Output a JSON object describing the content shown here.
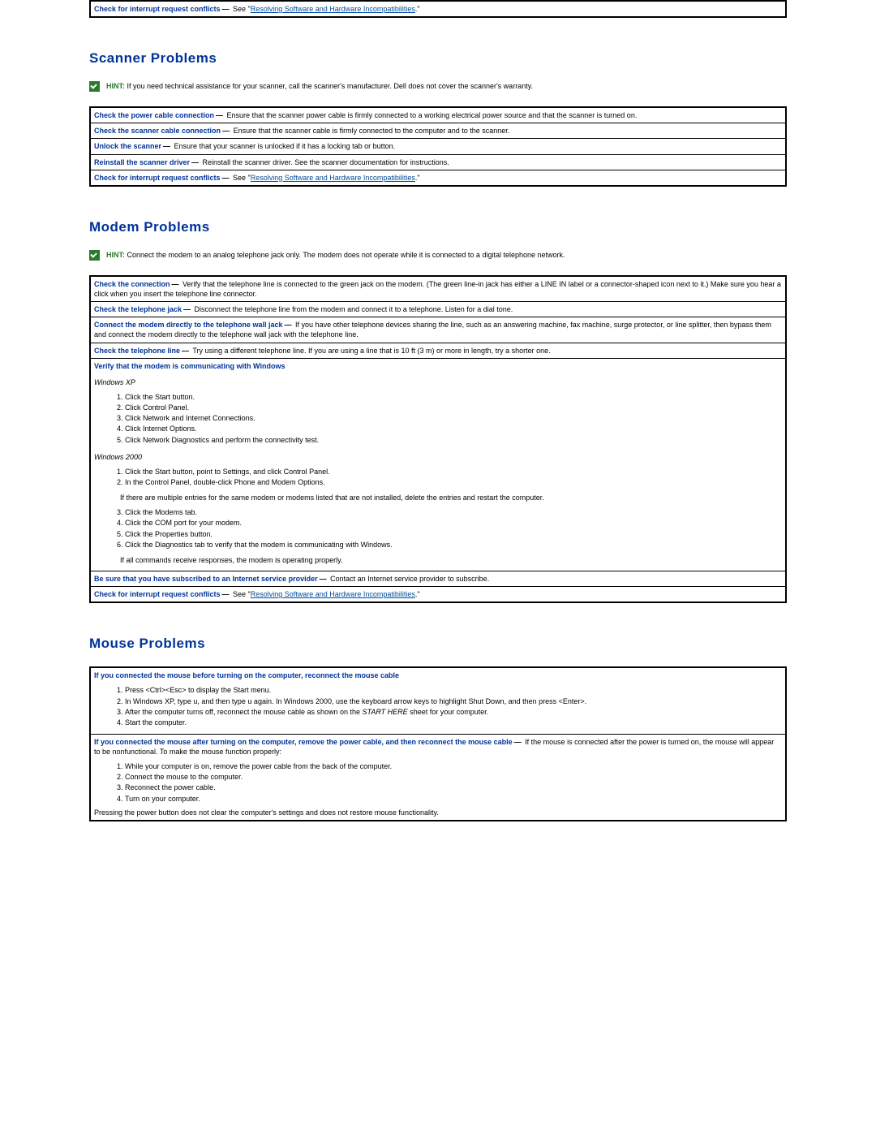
{
  "topOrphan": {
    "title": "Check for interrupt request conflicts",
    "sep": "—",
    "pre": " See \"",
    "link": "Resolving Software and Hardware Incompatibilities",
    "post": ".\""
  },
  "scanner": {
    "heading": "Scanner Problems",
    "hint": {
      "label": "HINT:",
      "text": " If you need technical assistance for your scanner, call the scanner's manufacturer. Dell does not cover the scanner's warranty."
    },
    "rows": [
      {
        "title": "Check the power cable connection",
        "sep": "—",
        "text": " Ensure that the scanner power cable is firmly connected to a working electrical power source and that the scanner is turned on."
      },
      {
        "title": "Check the scanner cable connection",
        "sep": "—",
        "text": " Ensure that the scanner cable is firmly connected to the computer and to the scanner."
      },
      {
        "title": "Unlock the scanner",
        "sep": "—",
        "text": " Ensure that your scanner is unlocked if it has a locking tab or button."
      },
      {
        "title": "Reinstall the scanner driver",
        "sep": "—",
        "text": " Reinstall the scanner driver. See the scanner documentation for instructions."
      },
      {
        "title": "Check for interrupt request conflicts",
        "sep": "—",
        "pre": " See \"",
        "link": "Resolving Software and Hardware Incompatibilities",
        "post": ".\""
      }
    ]
  },
  "modem": {
    "heading": "Modem Problems",
    "hint": {
      "label": "HINT:",
      "text": " Connect the modem to an analog telephone jack only. The modem does not operate while it is connected to a digital telephone network."
    },
    "rows": {
      "r1": {
        "title": "Check the connection",
        "sep": "—",
        "text": " Verify that the telephone line is connected to the green jack on the modem. (The green line-in jack has either a LINE IN label or a connector-shaped icon next to it.) Make sure you hear a click when you insert the telephone line connector."
      },
      "r2": {
        "title": "Check the telephone jack",
        "sep": "—",
        "text": " Disconnect the telephone line from the modem and connect it to a telephone. Listen for a dial tone."
      },
      "r3": {
        "title": "Connect the modem directly to the telephone wall jack",
        "sep": "—",
        "text": " If you have other telephone devices sharing the line, such as an answering machine, fax machine, surge protector, or line splitter, then bypass them and connect the modem directly to the telephone wall jack with the telephone line."
      },
      "r4": {
        "title": "Check the telephone line",
        "sep": "—",
        "text": " Try using a different telephone line. If you are using a line that is 10 ft (3 m) or more in length, try a shorter one."
      },
      "r5": {
        "title": "Verify that the modem is communicating with Windows",
        "xpLabel": "Windows XP",
        "xpSteps": [
          "Click the Start button.",
          "Click Control Panel.",
          "Click Network and Internet Connections.",
          "Click Internet Options.",
          "Click Network Diagnostics and perform the connectivity test."
        ],
        "w2kLabel": "Windows 2000",
        "w2kStepsA": [
          "Click the Start button, point to Settings, and click Control Panel.",
          "In the Control Panel, double-click Phone and Modem Options."
        ],
        "noteA": "If there are multiple entries for the same modem or modems listed that are not installed, delete the entries and restart the computer.",
        "w2kStepsB": [
          "Click the Modems tab.",
          "Click the COM port for your modem.",
          "Click the Properties button.",
          "Click the Diagnostics tab to verify that the modem is communicating with Windows."
        ],
        "noteB": "If all commands receive responses, the modem is operating properly."
      },
      "r6": {
        "title": "Be sure that you have subscribed to an Internet service provider",
        "sep": "—",
        "text": " Contact an Internet service provider to subscribe."
      },
      "r7": {
        "title": "Check for interrupt request conflicts",
        "sep": "—",
        "pre": " See \"",
        "link": "Resolving Software and Hardware Incompatibilities",
        "post": ".\""
      }
    }
  },
  "mouse": {
    "heading": "Mouse Problems",
    "rows": {
      "r1": {
        "title": "If you connected the mouse before turning on the computer, reconnect the mouse cable",
        "steps": [
          "Press <Ctrl><Esc> to display the Start menu.",
          "In Windows XP, type u, and then type u again. In Windows 2000, use the keyboard arrow keys to highlight Shut Down, and then press <Enter>.",
          "After the computer turns off, reconnect the mouse cable as shown on the ",
          "Start the computer."
        ],
        "startHere": "START HERE",
        "step3tail": " sheet for your computer."
      },
      "r2": {
        "title": "If you connected the mouse after turning on the computer, remove the power cable, and then reconnect the mouse cable",
        "sep": "—",
        "text": " If the mouse is connected after the power is turned on, the mouse will appear to be nonfunctional. To make the mouse function properly:",
        "steps": [
          "While your computer is on, remove the power cable from the back of the computer.",
          "Connect the mouse to the computer.",
          "Reconnect the power cable.",
          "Turn on your computer."
        ],
        "tail": "Pressing the power button does not clear the computer's settings and does not restore mouse functionality."
      }
    }
  }
}
